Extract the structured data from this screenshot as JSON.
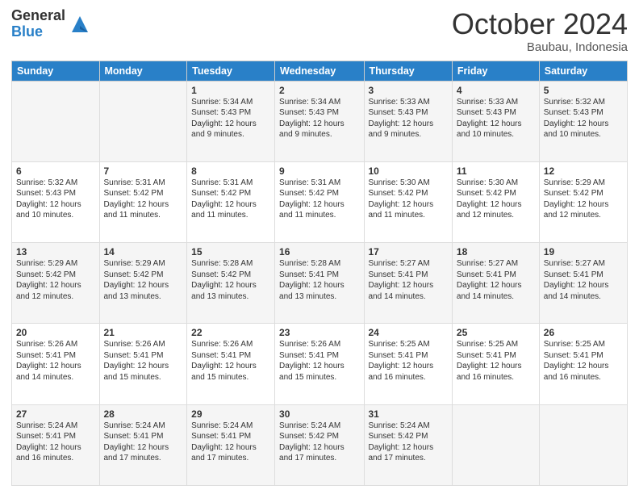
{
  "header": {
    "logo_general": "General",
    "logo_blue": "Blue",
    "month_title": "October 2024",
    "location": "Baubau, Indonesia"
  },
  "days_of_week": [
    "Sunday",
    "Monday",
    "Tuesday",
    "Wednesday",
    "Thursday",
    "Friday",
    "Saturday"
  ],
  "weeks": [
    [
      {
        "day": "",
        "detail": ""
      },
      {
        "day": "",
        "detail": ""
      },
      {
        "day": "1",
        "detail": "Sunrise: 5:34 AM\nSunset: 5:43 PM\nDaylight: 12 hours and 9 minutes."
      },
      {
        "day": "2",
        "detail": "Sunrise: 5:34 AM\nSunset: 5:43 PM\nDaylight: 12 hours and 9 minutes."
      },
      {
        "day": "3",
        "detail": "Sunrise: 5:33 AM\nSunset: 5:43 PM\nDaylight: 12 hours and 9 minutes."
      },
      {
        "day": "4",
        "detail": "Sunrise: 5:33 AM\nSunset: 5:43 PM\nDaylight: 12 hours and 10 minutes."
      },
      {
        "day": "5",
        "detail": "Sunrise: 5:32 AM\nSunset: 5:43 PM\nDaylight: 12 hours and 10 minutes."
      }
    ],
    [
      {
        "day": "6",
        "detail": "Sunrise: 5:32 AM\nSunset: 5:43 PM\nDaylight: 12 hours and 10 minutes."
      },
      {
        "day": "7",
        "detail": "Sunrise: 5:31 AM\nSunset: 5:42 PM\nDaylight: 12 hours and 11 minutes."
      },
      {
        "day": "8",
        "detail": "Sunrise: 5:31 AM\nSunset: 5:42 PM\nDaylight: 12 hours and 11 minutes."
      },
      {
        "day": "9",
        "detail": "Sunrise: 5:31 AM\nSunset: 5:42 PM\nDaylight: 12 hours and 11 minutes."
      },
      {
        "day": "10",
        "detail": "Sunrise: 5:30 AM\nSunset: 5:42 PM\nDaylight: 12 hours and 11 minutes."
      },
      {
        "day": "11",
        "detail": "Sunrise: 5:30 AM\nSunset: 5:42 PM\nDaylight: 12 hours and 12 minutes."
      },
      {
        "day": "12",
        "detail": "Sunrise: 5:29 AM\nSunset: 5:42 PM\nDaylight: 12 hours and 12 minutes."
      }
    ],
    [
      {
        "day": "13",
        "detail": "Sunrise: 5:29 AM\nSunset: 5:42 PM\nDaylight: 12 hours and 12 minutes."
      },
      {
        "day": "14",
        "detail": "Sunrise: 5:29 AM\nSunset: 5:42 PM\nDaylight: 12 hours and 13 minutes."
      },
      {
        "day": "15",
        "detail": "Sunrise: 5:28 AM\nSunset: 5:42 PM\nDaylight: 12 hours and 13 minutes."
      },
      {
        "day": "16",
        "detail": "Sunrise: 5:28 AM\nSunset: 5:41 PM\nDaylight: 12 hours and 13 minutes."
      },
      {
        "day": "17",
        "detail": "Sunrise: 5:27 AM\nSunset: 5:41 PM\nDaylight: 12 hours and 14 minutes."
      },
      {
        "day": "18",
        "detail": "Sunrise: 5:27 AM\nSunset: 5:41 PM\nDaylight: 12 hours and 14 minutes."
      },
      {
        "day": "19",
        "detail": "Sunrise: 5:27 AM\nSunset: 5:41 PM\nDaylight: 12 hours and 14 minutes."
      }
    ],
    [
      {
        "day": "20",
        "detail": "Sunrise: 5:26 AM\nSunset: 5:41 PM\nDaylight: 12 hours and 14 minutes."
      },
      {
        "day": "21",
        "detail": "Sunrise: 5:26 AM\nSunset: 5:41 PM\nDaylight: 12 hours and 15 minutes."
      },
      {
        "day": "22",
        "detail": "Sunrise: 5:26 AM\nSunset: 5:41 PM\nDaylight: 12 hours and 15 minutes."
      },
      {
        "day": "23",
        "detail": "Sunrise: 5:26 AM\nSunset: 5:41 PM\nDaylight: 12 hours and 15 minutes."
      },
      {
        "day": "24",
        "detail": "Sunrise: 5:25 AM\nSunset: 5:41 PM\nDaylight: 12 hours and 16 minutes."
      },
      {
        "day": "25",
        "detail": "Sunrise: 5:25 AM\nSunset: 5:41 PM\nDaylight: 12 hours and 16 minutes."
      },
      {
        "day": "26",
        "detail": "Sunrise: 5:25 AM\nSunset: 5:41 PM\nDaylight: 12 hours and 16 minutes."
      }
    ],
    [
      {
        "day": "27",
        "detail": "Sunrise: 5:24 AM\nSunset: 5:41 PM\nDaylight: 12 hours and 16 minutes."
      },
      {
        "day": "28",
        "detail": "Sunrise: 5:24 AM\nSunset: 5:41 PM\nDaylight: 12 hours and 17 minutes."
      },
      {
        "day": "29",
        "detail": "Sunrise: 5:24 AM\nSunset: 5:41 PM\nDaylight: 12 hours and 17 minutes."
      },
      {
        "day": "30",
        "detail": "Sunrise: 5:24 AM\nSunset: 5:42 PM\nDaylight: 12 hours and 17 minutes."
      },
      {
        "day": "31",
        "detail": "Sunrise: 5:24 AM\nSunset: 5:42 PM\nDaylight: 12 hours and 17 minutes."
      },
      {
        "day": "",
        "detail": ""
      },
      {
        "day": "",
        "detail": ""
      }
    ]
  ]
}
